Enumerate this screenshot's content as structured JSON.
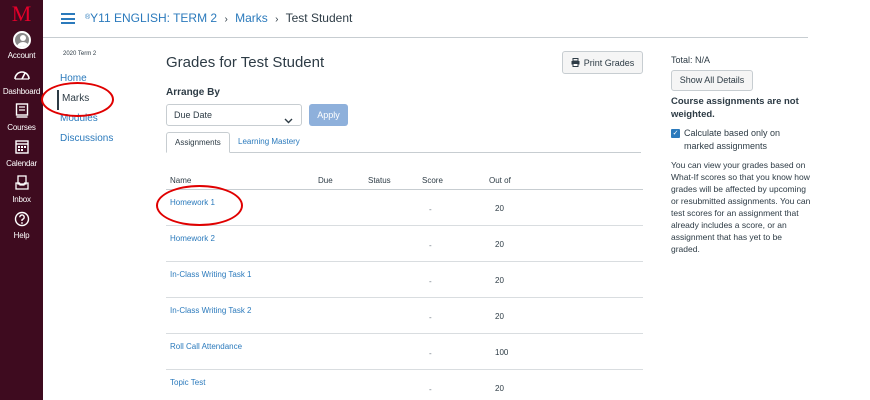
{
  "global_nav": {
    "logo": "M",
    "items": [
      {
        "label": "Account"
      },
      {
        "label": "Dashboard"
      },
      {
        "label": "Courses"
      },
      {
        "label": "Calendar"
      },
      {
        "label": "Inbox"
      },
      {
        "label": "Help"
      }
    ]
  },
  "header": {
    "course_prefix": "®",
    "course": "Y11 ENGLISH: TERM 2",
    "section": "Marks",
    "current": "Test Student"
  },
  "course_nav": {
    "term": "2020 Term 2",
    "items": [
      {
        "label": "Home"
      },
      {
        "label": "Marks"
      },
      {
        "label": "Modules"
      },
      {
        "label": "Discussions"
      }
    ]
  },
  "main": {
    "title": "Grades for Test Student",
    "print_label": "Print Grades",
    "arrange_label": "Arrange By",
    "arrange_value": "Due Date",
    "apply_label": "Apply",
    "tabs": [
      {
        "label": "Assignments"
      },
      {
        "label": "Learning Mastery"
      }
    ],
    "table": {
      "headers": {
        "name": "Name",
        "due": "Due",
        "status": "Status",
        "score": "Score",
        "out_of": "Out of"
      },
      "rows": [
        {
          "name": "Homework 1",
          "score": "-",
          "out_of": "20"
        },
        {
          "name": "Homework 2",
          "score": "-",
          "out_of": "20"
        },
        {
          "name": "In-Class Writing Task 1",
          "score": "-",
          "out_of": "20"
        },
        {
          "name": "In-Class Writing Task 2",
          "score": "-",
          "out_of": "20"
        },
        {
          "name": "Roll Call Attendance",
          "score": "-",
          "out_of": "100"
        },
        {
          "name": "Topic Test",
          "score": "-",
          "out_of": "20"
        }
      ]
    }
  },
  "sidebar": {
    "total": "Total: N/A",
    "show_details": "Show All Details",
    "weighting": "Course assignments are not weighted.",
    "calc_label": "Calculate based only on marked assignments",
    "calc_checked": true,
    "description": "You can view your grades based on What-If scores so that you know how grades will be affected by upcoming or resubmitted assignments. You can test scores for an assignment that already includes a score, or an assignment that has yet to be graded."
  },
  "colors": {
    "nav_bg": "#3e0b1f",
    "logo": "#e4002b",
    "link": "#2b7abc",
    "annotation": "#e00000"
  }
}
